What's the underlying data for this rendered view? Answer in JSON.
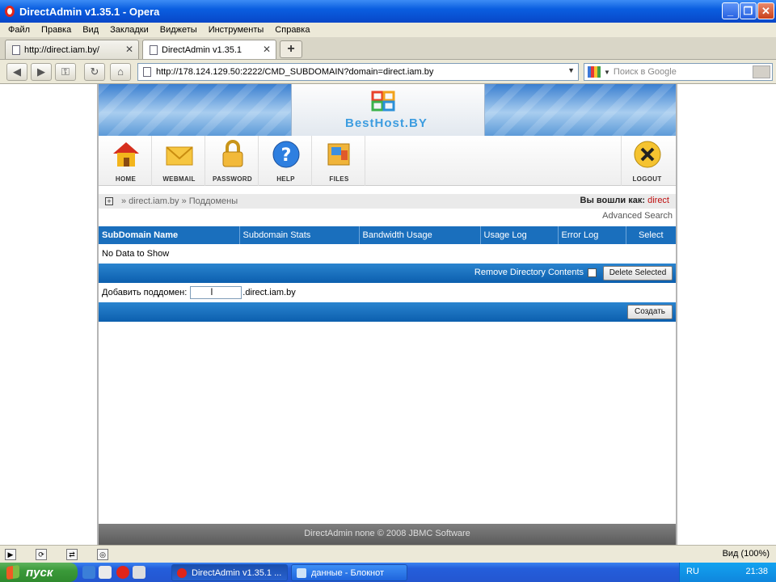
{
  "window": {
    "title": "DirectAdmin v1.35.1 - Opera",
    "buttons": [
      "_",
      "❐",
      "✕"
    ]
  },
  "menu": [
    "Файл",
    "Правка",
    "Вид",
    "Закладки",
    "Виджеты",
    "Инструменты",
    "Справка"
  ],
  "tabs": [
    {
      "label": "http://direct.iam.by/",
      "active": false
    },
    {
      "label": "DirectAdmin v1.35.1",
      "active": true
    }
  ],
  "address": {
    "url": "http://178.124.129.50:2222/CMD_SUBDOMAIN?domain=direct.iam.by",
    "search_placeholder": "Поиск в Google"
  },
  "logo": {
    "text": "BestHost.BY"
  },
  "nav": [
    {
      "label": "HOME",
      "icon": "home-icon"
    },
    {
      "label": "WEBMAIL",
      "icon": "mail-icon"
    },
    {
      "label": "PASSWORD",
      "icon": "lock-icon"
    },
    {
      "label": "HELP",
      "icon": "help-icon"
    },
    {
      "label": "FILES",
      "icon": "files-icon"
    },
    {
      "label": "LOGOUT",
      "icon": "logout-icon"
    }
  ],
  "breadcrumb": {
    "text": "» direct.iam.by » Поддомены",
    "logged_label": "Вы вошли как:",
    "user": "direct"
  },
  "advanced_search": "Advanced Search",
  "table": {
    "headers": [
      "SubDomain Name",
      "Subdomain Stats",
      "Bandwidth Usage",
      "Usage Log",
      "Error Log",
      "Select"
    ],
    "empty": "No Data to Show"
  },
  "actions": {
    "remove_label": "Remove Directory Contents",
    "delete_button": "Delete Selected"
  },
  "add": {
    "label": "Добавить поддомен:",
    "suffix": ".direct.iam.by",
    "value": "",
    "create_button": "Создать"
  },
  "footer": "DirectAdmin none © 2008 JBMC Software",
  "status": {
    "zoom": "Вид (100%)"
  },
  "taskbar": {
    "start": "пуск",
    "tasks": [
      {
        "label": "DirectAdmin v1.35.1 ...",
        "active": true
      },
      {
        "label": "данные - Блокнот",
        "active": false
      }
    ],
    "lang": "RU",
    "clock": "21:38"
  },
  "colors": {
    "accent": "#1a6fbd",
    "user": "#c01010",
    "logo": "#3d9de0"
  }
}
